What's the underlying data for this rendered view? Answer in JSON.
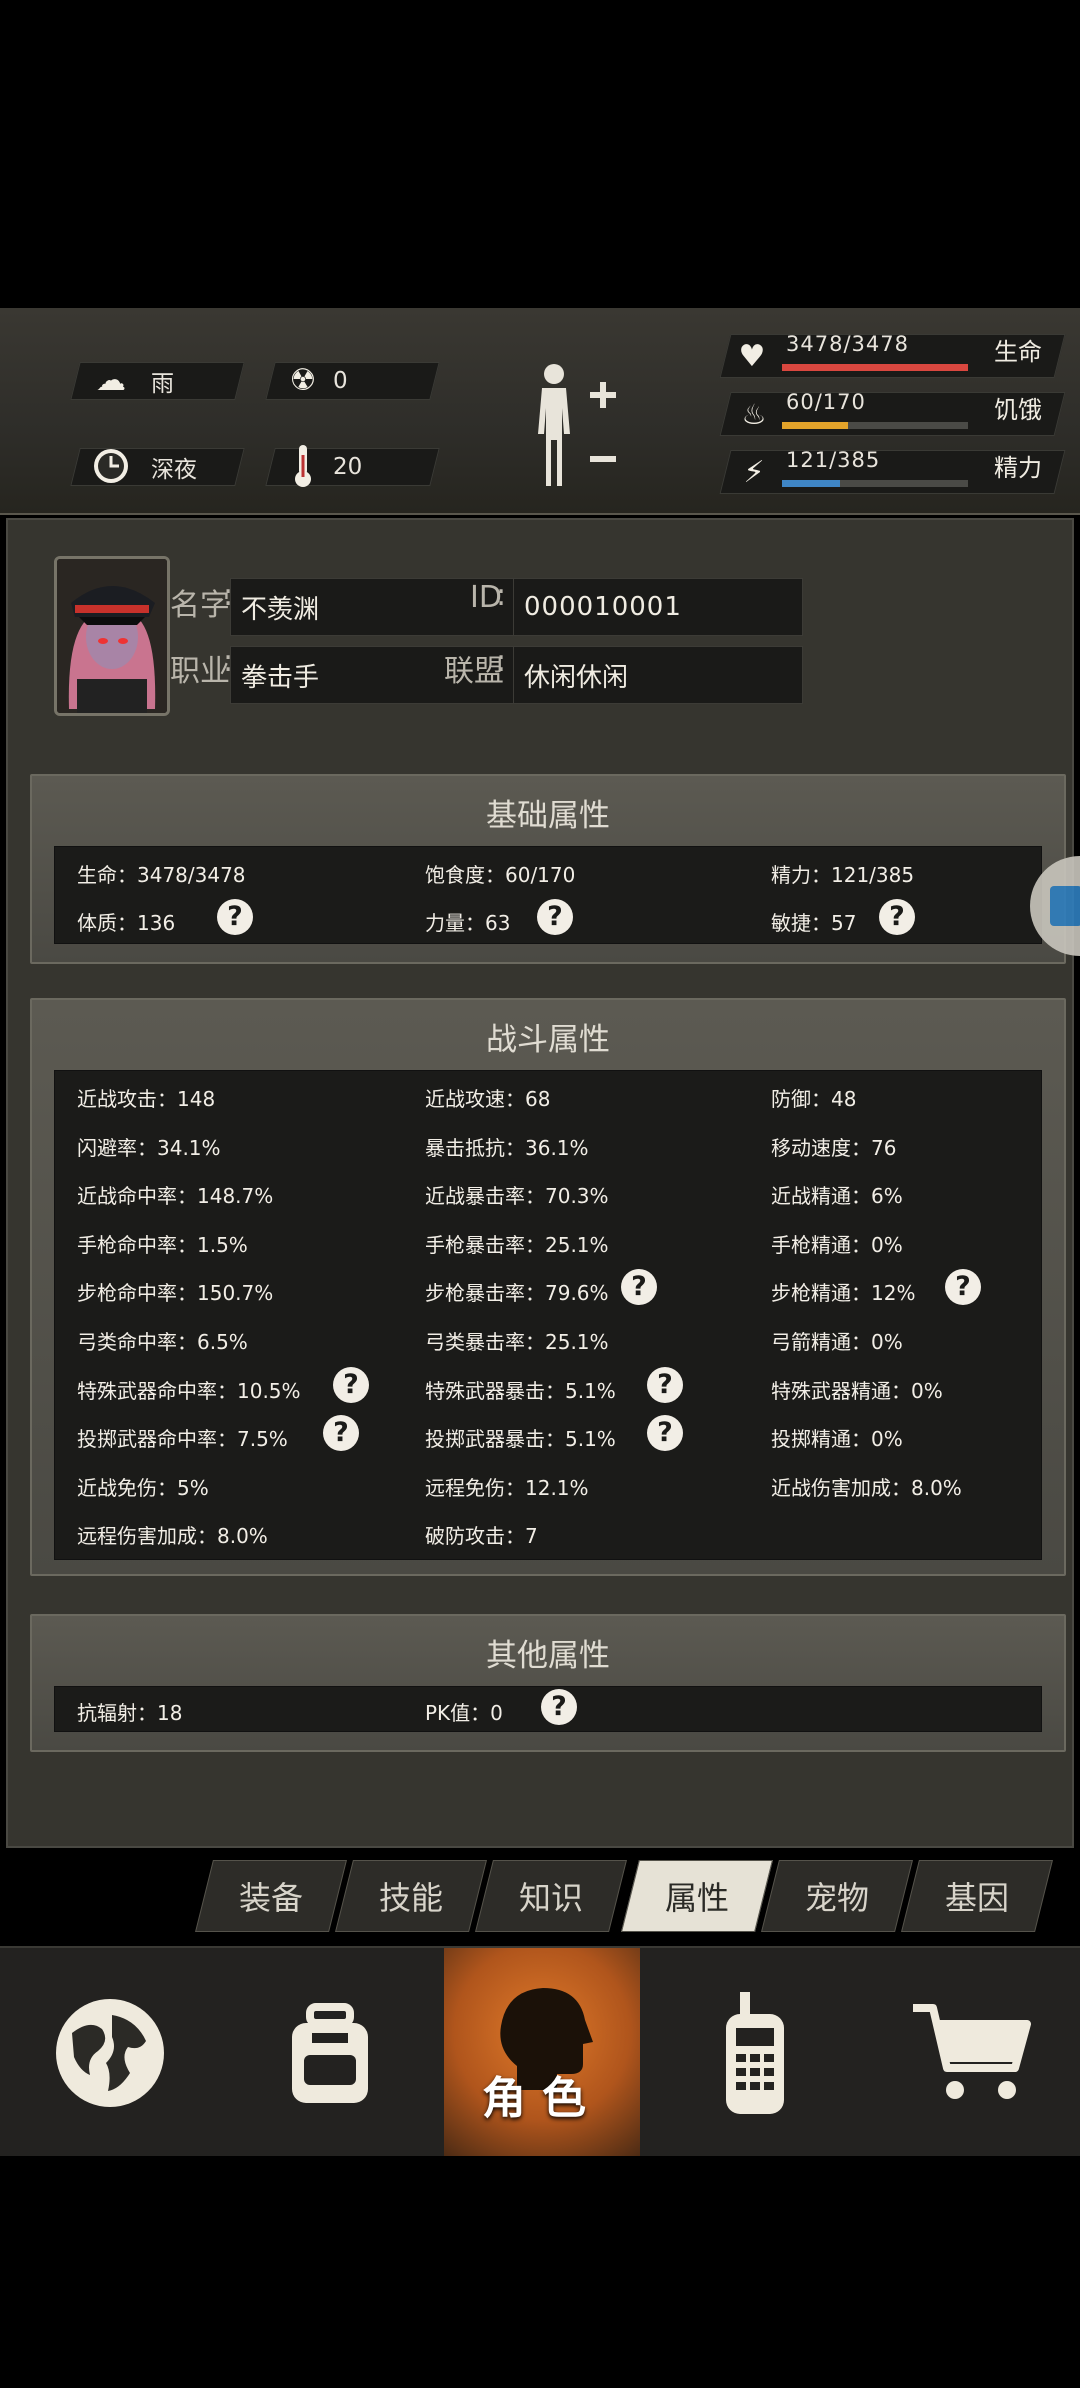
{
  "hud": {
    "weather": "雨",
    "radiation": "0",
    "time_of_day": "深夜",
    "temperature": "20",
    "life": {
      "text": "3478/3478",
      "label": "生命",
      "value": 3478,
      "max": 3478,
      "color": "#d9473f"
    },
    "hunger": {
      "text": "60/170",
      "label": "饥饿",
      "value": 60,
      "max": 170,
      "color": "#e3a32a"
    },
    "energy": {
      "text": "121/385",
      "label": "精力",
      "value": 121,
      "max": 385,
      "color": "#3f86c6"
    }
  },
  "profile": {
    "name_label": "名字",
    "name": "不羡渊",
    "id_label": "ID",
    "id": "000010001",
    "job_label": "职业",
    "job": "拳击手",
    "guild_label": "联盟",
    "guild": "休闲休闲"
  },
  "basic": {
    "title": "基础属性",
    "rows": [
      [
        "生命：3478/3478",
        "饱食度：60/170",
        "精力：121/385"
      ],
      [
        "体质：136",
        "力量：63",
        "敏捷：57"
      ]
    ]
  },
  "combat": {
    "title": "战斗属性",
    "rows": [
      [
        "近战攻击：148",
        "近战攻速：68",
        "防御：48"
      ],
      [
        "闪避率：34.1%",
        "暴击抵抗：36.1%",
        "移动速度：76"
      ],
      [
        "近战命中率：148.7%",
        "近战暴击率：70.3%",
        "近战精通：6%"
      ],
      [
        "手枪命中率：1.5%",
        "手枪暴击率：25.1%",
        "手枪精通：0%"
      ],
      [
        "步枪命中率：150.7%",
        "步枪暴击率：79.6%",
        "步枪精通：12%"
      ],
      [
        "弓类命中率：6.5%",
        "弓类暴击率：25.1%",
        "弓箭精通：0%"
      ],
      [
        "特殊武器命中率：10.5%",
        "特殊武器暴击：5.1%",
        "特殊武器精通：0%"
      ],
      [
        "投掷武器命中率：7.5%",
        "投掷武器暴击：5.1%",
        "投掷精通：0%"
      ],
      [
        "近战免伤：5%",
        "远程免伤：12.1%",
        "近战伤害加成：8.0%"
      ],
      [
        "远程伤害加成：8.0%",
        "破防攻击：7",
        ""
      ]
    ]
  },
  "other": {
    "title": "其他属性",
    "rows": [
      [
        "抗辐射：18",
        "PK值：0",
        ""
      ]
    ]
  },
  "tabs": [
    "装备",
    "技能",
    "知识",
    "属性",
    "宠物",
    "基因"
  ],
  "active_tab": "属性",
  "nav": {
    "active_label": "角色"
  }
}
